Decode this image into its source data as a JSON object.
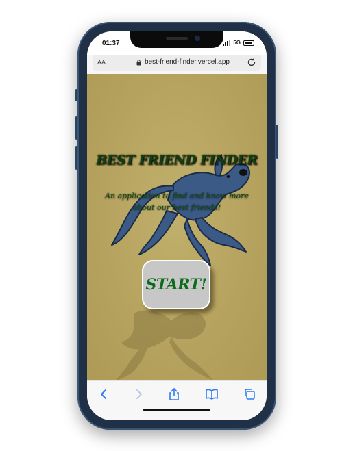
{
  "status_bar": {
    "time": "01:37",
    "network": "5G"
  },
  "browser": {
    "text_size_label": "AA",
    "url": "best-friend-finder.vercel.app"
  },
  "hero": {
    "title": "BEST FRIEND FINDER",
    "subtitle": "An application to find and know more about our best friends!",
    "start_label": "START!"
  },
  "colors": {
    "background": "#b6a35f",
    "title_green": "#123f12",
    "button_text": "#0d6b1c",
    "button_bg": "#c7c7c7",
    "dog_blue": "#3b5a86",
    "ios_blue": "#2f7bf5"
  },
  "toolbar": {
    "icons": [
      "back-icon",
      "forward-icon",
      "share-icon",
      "bookmarks-icon",
      "tabs-icon"
    ]
  }
}
